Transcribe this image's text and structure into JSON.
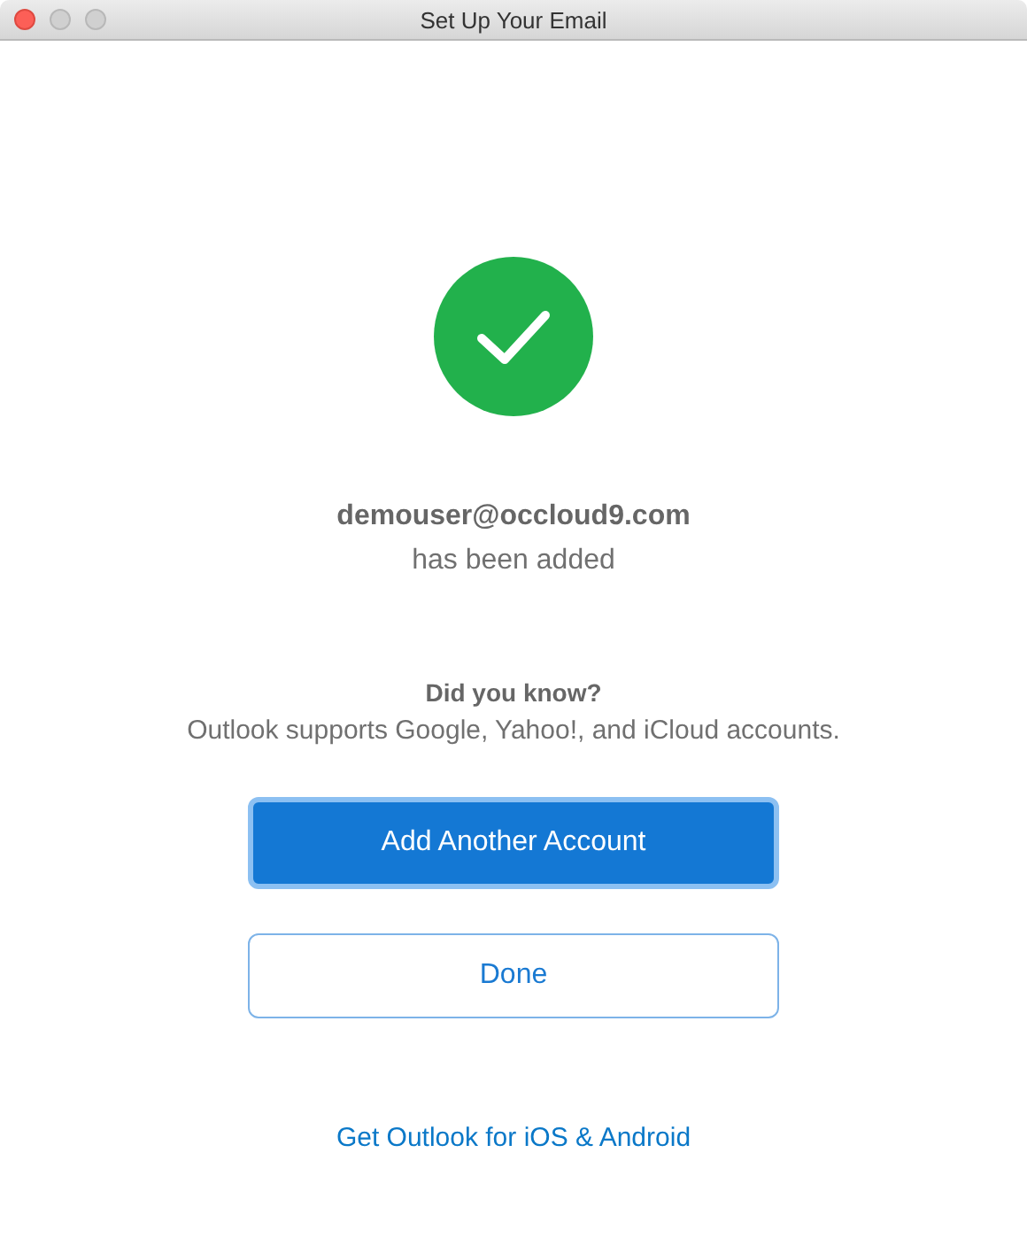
{
  "window": {
    "title": "Set Up Your Email",
    "controls": [
      {
        "kind": "close",
        "disabled": false
      },
      {
        "kind": "minimize",
        "disabled": true
      },
      {
        "kind": "zoom",
        "disabled": true
      }
    ]
  },
  "status": {
    "kind": "success",
    "email": "demouser@occloud9.com",
    "message": "has been added"
  },
  "tip": {
    "heading": "Did you know?",
    "text": "Outlook supports Google, Yahoo!, and iCloud accounts."
  },
  "buttons": [
    {
      "label": "Add Another Account",
      "kind": "primary"
    },
    {
      "label": "Done",
      "kind": "secondary"
    }
  ],
  "link": "Get Outlook for iOS & Android"
}
